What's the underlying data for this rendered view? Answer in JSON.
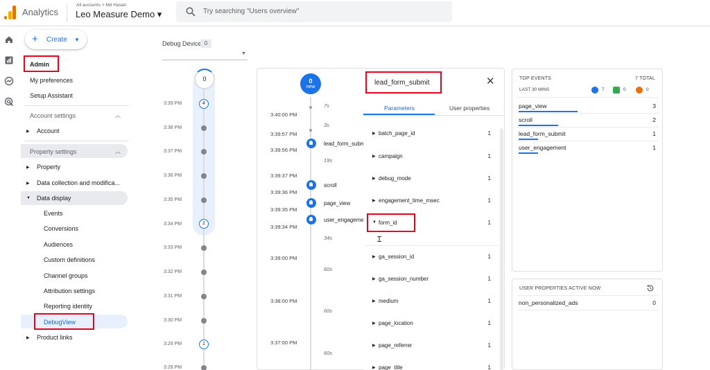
{
  "header": {
    "app_name": "Analytics",
    "breadcrumb": "All accounts > Md Hasan",
    "property_name": "Leo Measure Demo ▾",
    "search_placeholder": "Try searching \"Users overview\""
  },
  "sidebar": {
    "create_label": "Create",
    "admin": "Admin",
    "my_preferences": "My preferences",
    "setup_assistant": "Setup Assistant",
    "account_settings": "Account settings",
    "account": "Account",
    "property_settings": "Property settings",
    "property": "Property",
    "data_collection": "Data collection and modifica...",
    "data_display": "Data display",
    "sub_items": [
      "Events",
      "Conversions",
      "Audiences",
      "Custom definitions",
      "Channel groups",
      "Attribution settings",
      "Reporting identity",
      "DebugView"
    ],
    "product_links": "Product links"
  },
  "debug_device": {
    "label": "Debug Device",
    "count": "0"
  },
  "minutes": {
    "top_count": "0",
    "times": [
      "3:39 PM",
      "3:38 PM",
      "3:37 PM",
      "3:36 PM",
      "3:35 PM",
      "3:34 PM",
      "3:33 PM",
      "3:32 PM",
      "3:31 PM",
      "3:30 PM",
      "3:29 PM",
      "3:28 PM"
    ],
    "counts": [
      "4",
      "2",
      "1"
    ]
  },
  "seconds": {
    "badge_number": "0",
    "badge_word": "new",
    "times": [
      "3:40:00 PM",
      "3:39:57 PM",
      "3:39:56 PM",
      "3:39:37 PM",
      "3:39:36 PM",
      "3:39:35 PM",
      "3:39:34 PM",
      "3:39:00 PM",
      "3:38:00 PM",
      "3:37:00 PM"
    ],
    "gaps": [
      "7s",
      "3s",
      "19s",
      "34s",
      "60s",
      "60s",
      "60s"
    ],
    "events": [
      "lead_form_submit",
      "scroll",
      "page_view",
      "user_engagement"
    ]
  },
  "event_detail": {
    "title": "lead_form_submit",
    "tabs": [
      "Parameters",
      "User properties"
    ],
    "params": [
      {
        "name": "batch_page_id",
        "count": "1"
      },
      {
        "name": "campaign",
        "count": "1"
      },
      {
        "name": "debug_mode",
        "count": "1"
      },
      {
        "name": "engagement_time_msec",
        "count": "1"
      },
      {
        "name": "form_id",
        "count": "1"
      },
      {
        "name": "ga_session_id",
        "count": "1"
      },
      {
        "name": "ga_session_number",
        "count": "1"
      },
      {
        "name": "medium",
        "count": "1"
      },
      {
        "name": "page_location",
        "count": "1"
      },
      {
        "name": "page_referrer",
        "count": "1"
      },
      {
        "name": "page_title",
        "count": "1"
      }
    ]
  },
  "top_events": {
    "title": "TOP EVENTS",
    "total": "7 TOTAL",
    "subtitle": "LAST 30 MINS",
    "legend": [
      {
        "count": "7",
        "color": "#1a73e8"
      },
      {
        "count": "0",
        "color": "#34a853"
      },
      {
        "count": "0",
        "color": "#e8710a"
      }
    ],
    "rows": [
      {
        "name": "page_view",
        "value": "3",
        "share": 0.43
      },
      {
        "name": "scroll",
        "value": "2",
        "share": 0.29
      },
      {
        "name": "lead_form_submit",
        "value": "1",
        "share": 0.14
      },
      {
        "name": "user_engagement",
        "value": "1",
        "share": 0.14
      }
    ]
  },
  "user_properties": {
    "title": "USER PROPERTIES ACTIVE NOW",
    "rows": [
      {
        "name": "non_personalized_ads",
        "value": "0"
      }
    ]
  },
  "colors": {
    "accent": "#1a73e8",
    "highlight": "#e8001c"
  }
}
